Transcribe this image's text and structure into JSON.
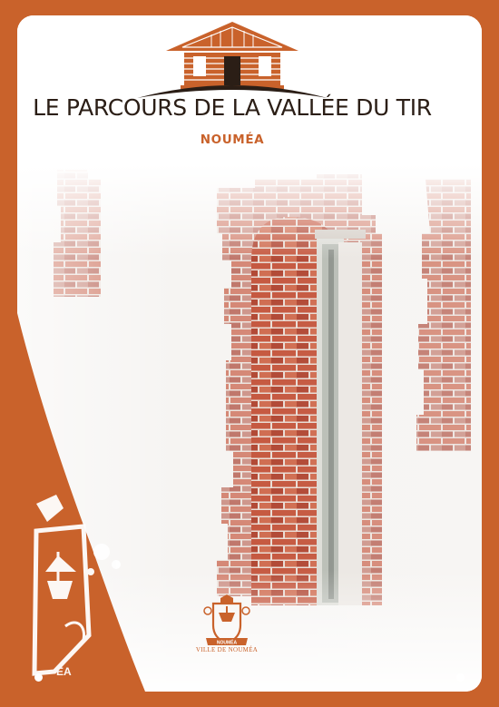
{
  "cover": {
    "title": "LE PARCOURS DE LA VALLÉE DU TIR",
    "subtitle": "NOUMÉA",
    "crest_caption": "VILLE DE NOUMÉA",
    "crest_ribbon": "NOUMÉA"
  },
  "colors": {
    "brand_orange": "#c9622b",
    "title_dark": "#2b1e16",
    "brick_red": "#b84a32",
    "wall_white": "#ffffff"
  },
  "icons": {
    "logo": "house-icon",
    "crest": "coat-of-arms-icon",
    "emblem": "city-emblem-icon"
  }
}
